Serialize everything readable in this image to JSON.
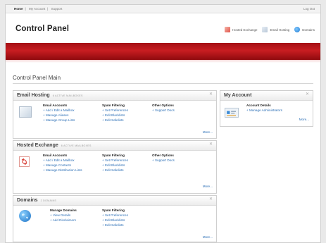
{
  "topbar": {
    "crumbs": [
      {
        "label": "Home"
      },
      {
        "label": "My Account"
      },
      {
        "label": "Support"
      }
    ],
    "logout": "Log Out"
  },
  "header": {
    "title": "Control Panel",
    "quicklinks": [
      {
        "label": "Hosted Exchange",
        "icon": "exchange-icon"
      },
      {
        "label": "Email Hosting",
        "icon": "email-icon"
      },
      {
        "label": "Domains",
        "icon": "domains-icon"
      }
    ]
  },
  "main": {
    "title": "Control Panel Main",
    "more_label": "More...",
    "panels": {
      "email_hosting": {
        "title": "Email Hosting",
        "subtitle": "6 active mailboxes",
        "columns": [
          {
            "title": "Email Accounts",
            "links": [
              "+ Add / Edit a Mailbox",
              "+ Manage Aliases",
              "+ Manage Group Lists"
            ]
          },
          {
            "title": "Spam Filtering",
            "links": [
              "+ Set Preferences",
              "+ Edit Blacklists",
              "+ Edit Safelists"
            ]
          },
          {
            "title": "Other Options",
            "links": [
              "+ Support Docs"
            ]
          }
        ]
      },
      "hosted_exchange": {
        "title": "Hosted Exchange",
        "subtitle": "6 active mailboxes",
        "columns": [
          {
            "title": "Email Accounts",
            "links": [
              "+ Add / Edit a Mailbox",
              "+ Manage Contacts",
              "+ Manage Distribution Lists"
            ]
          },
          {
            "title": "Spam Filtering",
            "links": [
              "+ Set Preferences",
              "+ Edit Blacklists",
              "+ Edit Safelists"
            ]
          },
          {
            "title": "Other Options",
            "links": [
              "+ Support Docs"
            ]
          }
        ]
      },
      "domains": {
        "title": "Domains",
        "subtitle": "2 domains",
        "columns": [
          {
            "title": "Manage Domains",
            "links": [
              "+ View Details",
              "+ Add Disclaimers"
            ]
          },
          {
            "title": "Spam Filtering",
            "links": [
              "+ Set Preferences",
              "+ Edit Blacklists",
              "+ Edit Safelists"
            ]
          }
        ]
      },
      "my_account": {
        "title": "My Account",
        "columns": [
          {
            "title": "Account Details",
            "links": [
              "+ Manage Administrators"
            ]
          }
        ]
      }
    }
  },
  "colors": {
    "brand_red": "#b3161b",
    "link_blue": "#2c6fb6"
  }
}
